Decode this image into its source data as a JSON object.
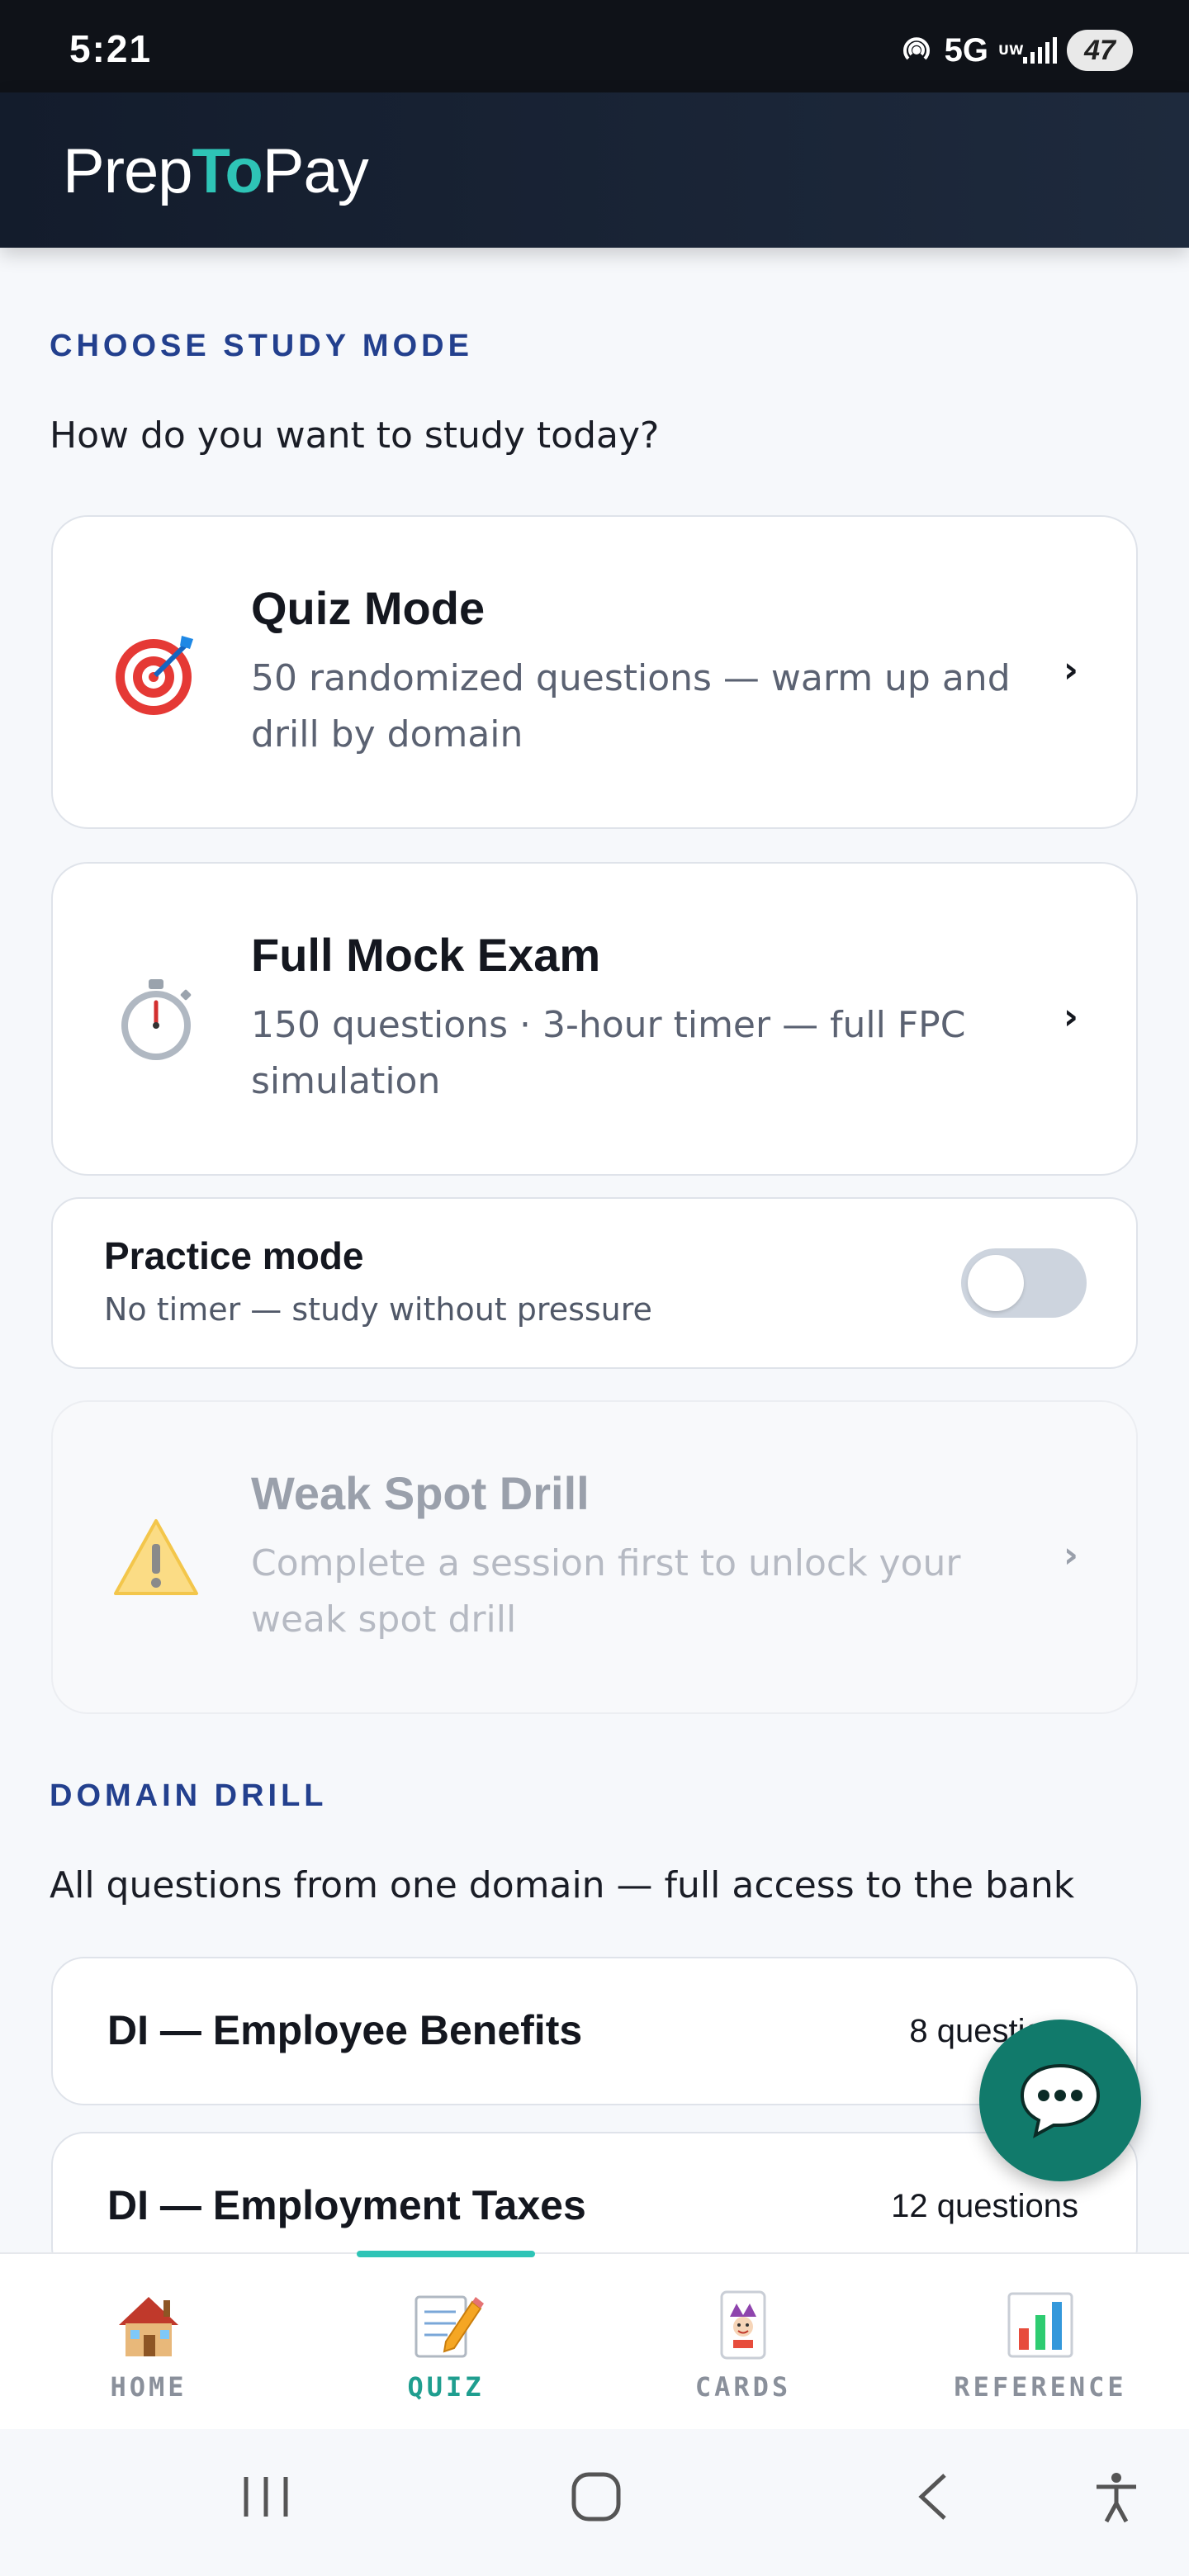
{
  "status_bar": {
    "time": "5:21",
    "network": "5G",
    "network_sup": "UW",
    "battery": "47"
  },
  "app": {
    "logo_prep": "Prep",
    "logo_to": "To",
    "logo_pay": "Pay",
    "accent_color": "#2ec4b6"
  },
  "study_mode": {
    "section_label": "CHOOSE STUDY MODE",
    "prompt": "How do you want to study today?",
    "modes": [
      {
        "icon": "target-icon",
        "title": "Quiz Mode",
        "description": "50 randomized questions — warm up and drill by domain",
        "enabled": true
      },
      {
        "icon": "stopwatch-icon",
        "title": "Full Mock Exam",
        "description": "150 questions · 3-hour timer — full FPC simulation",
        "enabled": true
      },
      {
        "icon": "warning-icon",
        "title": "Weak Spot Drill",
        "description": "Complete a session first to unlock your weak spot drill",
        "enabled": false
      }
    ],
    "practice": {
      "title": "Practice mode",
      "subtitle": "No timer — study without pressure",
      "enabled": false
    }
  },
  "domain_drill": {
    "section_label": "DOMAIN DRILL",
    "prompt": "All questions from one domain — full access to the bank",
    "domains": [
      {
        "name": "DI — Employee Benefits",
        "count": "8 questions"
      },
      {
        "name": "DI — Employment Taxes",
        "count": "12 questions"
      }
    ]
  },
  "chat_fab": {
    "icon": "chat-bubble-icon"
  },
  "bottom_nav": {
    "active": "quiz",
    "items": [
      {
        "id": "home",
        "label": "HOME",
        "icon": "house-icon"
      },
      {
        "id": "quiz",
        "label": "QUIZ",
        "icon": "memo-pencil-icon"
      },
      {
        "id": "cards",
        "label": "CARDS",
        "icon": "joker-card-icon"
      },
      {
        "id": "reference",
        "label": "REFERENCE",
        "icon": "bar-chart-icon"
      }
    ]
  }
}
